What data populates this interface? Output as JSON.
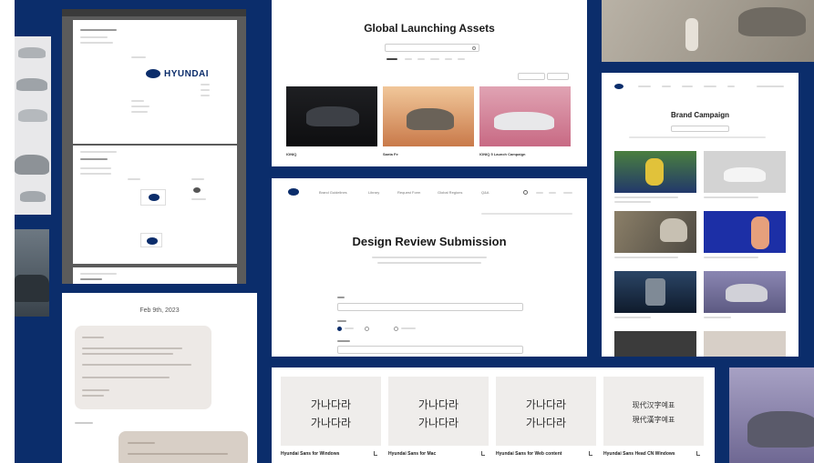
{
  "global_assets": {
    "title": "Global Launching Assets",
    "cards": [
      "IONIQ",
      "Santa Fe",
      "IONIQ 5 Launch Campaign"
    ]
  },
  "design_review": {
    "title": "Design Review Submission",
    "nav": [
      "Brand Guidelines",
      "Library",
      "Request Form",
      "Global Regions",
      "Q&A"
    ]
  },
  "brand_campaign": {
    "title": "Brand Campaign"
  },
  "brand_doc": {
    "logo_text": "HYUNDAI"
  },
  "chat": {
    "date": "Feb 9th, 2023"
  },
  "fonts": {
    "cards": [
      {
        "sample_line1": "가나다라",
        "sample_line2": "가나다라",
        "label": "Hyundai Sans for Windows"
      },
      {
        "sample_line1": "가나다라",
        "sample_line2": "가나다라",
        "label": "Hyundai Sans for Mac"
      },
      {
        "sample_line1": "가나다라",
        "sample_line2": "가나다라",
        "label": "Hyundai Sans for Web content"
      },
      {
        "sample_line1": "现代汉字예표",
        "sample_line2": "現代漢字예표",
        "label": "Hyundai Sans Head CN Windows"
      }
    ]
  },
  "colors": {
    "background": "#0b2d6b",
    "panel": "#ffffff",
    "chat_bubble": "#ede9e6",
    "reply_bubble": "#d8cfc6"
  }
}
